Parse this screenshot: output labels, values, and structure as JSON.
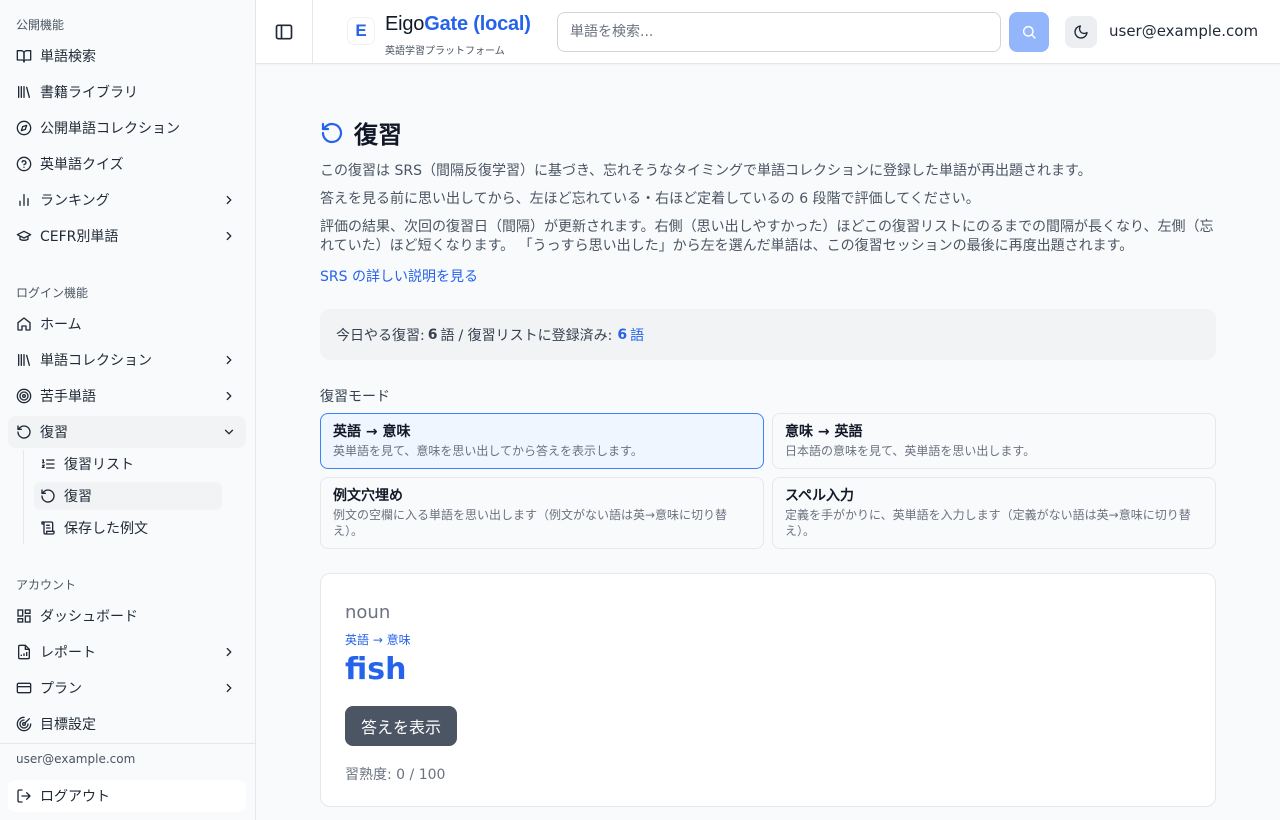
{
  "sidebar": {
    "public_title": "公開機能",
    "public_items": [
      {
        "label": "単語検索",
        "icon": "book-open-icon"
      },
      {
        "label": "書籍ライブラリ",
        "icon": "library-icon"
      },
      {
        "label": "公開単語コレクション",
        "icon": "compass-icon"
      },
      {
        "label": "英単語クイズ",
        "icon": "help-circle-icon"
      },
      {
        "label": "ランキング",
        "icon": "bar-chart-icon"
      },
      {
        "label": "CEFR別単語",
        "icon": "graduation-cap-icon"
      }
    ],
    "login_title": "ログイン機能",
    "login_items": [
      {
        "label": "ホーム",
        "icon": "home-icon"
      },
      {
        "label": "単語コレクション",
        "icon": "library-icon"
      },
      {
        "label": "苦手単語",
        "icon": "target-icon"
      },
      {
        "label": "復習",
        "icon": "rotate-ccw-icon"
      }
    ],
    "review_sub": [
      {
        "label": "復習リスト",
        "icon": "list-ordered-icon"
      },
      {
        "label": "復習",
        "icon": "rotate-ccw-icon"
      },
      {
        "label": "保存した例文",
        "icon": "scroll-text-icon"
      }
    ],
    "account_title": "アカウント",
    "account_items": [
      {
        "label": "ダッシュボード",
        "icon": "dashboard-icon"
      },
      {
        "label": "レポート",
        "icon": "file-chart-icon"
      },
      {
        "label": "プラン",
        "icon": "credit-card-icon"
      },
      {
        "label": "目標設定",
        "icon": "goal-icon"
      }
    ],
    "user_email": "user@example.com",
    "logout": "ログアウト"
  },
  "header": {
    "logo_letter": "E",
    "brand_part1": "Eigo",
    "brand_part2": "Gate (local)",
    "brand_sub": "英語学習プラットフォーム",
    "search_placeholder": "単語を検索...",
    "user_email": "user@example.com"
  },
  "main": {
    "title": "復習",
    "desc1": "この復習は SRS（間隔反復学習）に基づき、忘れそうなタイミングで単語コレクションに登録した単語が再出題されます。",
    "desc2": "答えを見る前に思い出してから、左ほど忘れている・右ほど定着しているの 6 段階で評価してください。",
    "desc3": "評価の結果、次回の復習日（間隔）が更新されます。右側（思い出しやすかった）ほどこの復習リストにのるまでの間隔が長くなり、左側（忘れていた）ほど短くなります。 「うっすら思い出した」から左を選んだ単語は、この復習セッションの最後に再度出題されます。",
    "srs_link": "SRS の詳しい説明を見る",
    "stats": {
      "today_label": "今日やる復習:",
      "today_count": "6",
      "unit": "語",
      "sep": "/ 復習リストに登録済み:",
      "registered_count": "6",
      "registered_unit": "語"
    },
    "mode_label": "復習モード",
    "modes": [
      {
        "title": "英語 → 意味",
        "desc": "英単語を見て、意味を思い出してから答えを表示します。"
      },
      {
        "title": "意味 → 英語",
        "desc": "日本語の意味を見て、英単語を思い出します。"
      },
      {
        "title": "例文穴埋め",
        "desc": "例文の空欄に入る単語を思い出します（例文がない語は英→意味に切り替え）。"
      },
      {
        "title": "スペル入力",
        "desc": "定義を手がかりに、英単語を入力します（定義がない語は英→意味に切り替え）。"
      }
    ],
    "card": {
      "pos": "noun",
      "mode": "英語 → 意味",
      "word": "fish",
      "reveal_button": "答えを表示",
      "mastery": "習熟度: 0 / 100"
    }
  },
  "colors": {
    "accent": "#2563eb",
    "selected_bg": "#eff6ff",
    "button_dark": "#4b5563",
    "search_button": "#93b5fb"
  }
}
